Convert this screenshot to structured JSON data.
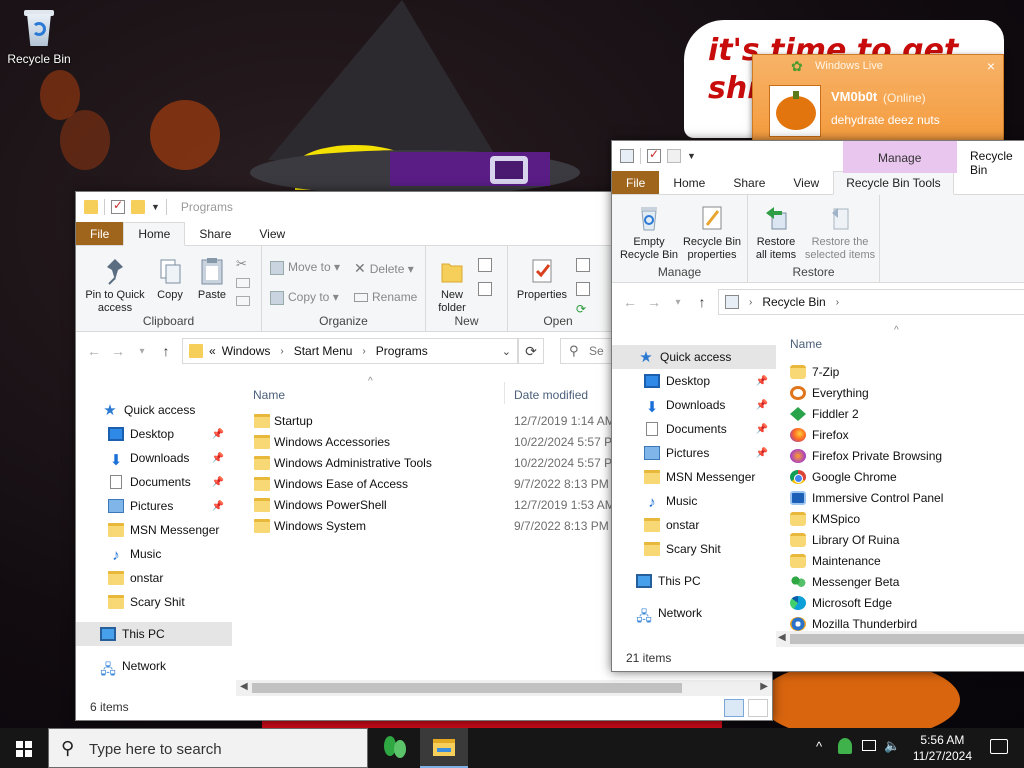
{
  "desktop": {
    "recycle_bin_label": "Recycle Bin",
    "wallpaper_text": "it's time to get shit and or t"
  },
  "msn_popup": {
    "app_title": "Windows Live",
    "contact_name": "VM0b0t",
    "status": "(Online)",
    "message": "dehydrate deez nuts",
    "close_glyph": "×"
  },
  "programs_window": {
    "title": "Programs",
    "tabs": [
      "File",
      "Home",
      "Share",
      "View"
    ],
    "active_tab": "Home",
    "ribbon": {
      "clipboard": {
        "pin": "Pin to Quick access",
        "copy": "Copy",
        "paste": "Paste",
        "label": "Clipboard"
      },
      "organize": {
        "move_to": "Move to",
        "copy_to": "Copy to",
        "delete": "Delete",
        "rename": "Rename",
        "label": "Organize"
      },
      "new": {
        "new_folder": "New folder",
        "label": "New"
      },
      "open": {
        "properties": "Properties",
        "label": "Open"
      }
    },
    "breadcrumb": [
      "«",
      "Windows",
      "Start Menu",
      "Programs"
    ],
    "search_placeholder": "Se",
    "columns": {
      "name": "Name",
      "date_modified": "Date modified"
    },
    "nav": {
      "quick_access": "Quick access",
      "items": [
        {
          "label": "Desktop",
          "pinned": true
        },
        {
          "label": "Downloads",
          "pinned": true
        },
        {
          "label": "Documents",
          "pinned": true
        },
        {
          "label": "Pictures",
          "pinned": true
        },
        {
          "label": "MSN Messenger",
          "pinned": false
        },
        {
          "label": "Music",
          "pinned": false
        },
        {
          "label": "onstar",
          "pinned": false
        },
        {
          "label": "Scary Shit",
          "pinned": false
        }
      ],
      "this_pc": "This PC",
      "network": "Network"
    },
    "files": [
      {
        "name": "Startup",
        "date": "12/7/2019 1:14 AM"
      },
      {
        "name": "Windows Accessories",
        "date": "10/22/2024 5:57 PM"
      },
      {
        "name": "Windows Administrative Tools",
        "date": "10/22/2024 5:57 PM"
      },
      {
        "name": "Windows Ease of Access",
        "date": "9/7/2022 8:13 PM"
      },
      {
        "name": "Windows PowerShell",
        "date": "12/7/2019 1:53 AM"
      },
      {
        "name": "Windows System",
        "date": "9/7/2022 8:13 PM"
      }
    ],
    "status": "6 items"
  },
  "recycle_window": {
    "title": "Recycle Bin",
    "contextual_group": "Manage",
    "tabs": [
      "File",
      "Home",
      "Share",
      "View",
      "Recycle Bin Tools"
    ],
    "active_tab": "Recycle Bin Tools",
    "ribbon": {
      "manage": {
        "empty": "Empty Recycle Bin",
        "properties": "Recycle Bin properties",
        "label": "Manage"
      },
      "restore": {
        "restore_all": "Restore all items",
        "restore_selected": "Restore the selected items",
        "label": "Restore"
      }
    },
    "breadcrumb": [
      "Recycle Bin"
    ],
    "columns": {
      "name": "Name"
    },
    "nav": {
      "quick_access": "Quick access",
      "items": [
        {
          "label": "Desktop",
          "pinned": true
        },
        {
          "label": "Downloads",
          "pinned": true
        },
        {
          "label": "Documents",
          "pinned": true
        },
        {
          "label": "Pictures",
          "pinned": true
        },
        {
          "label": "MSN Messenger",
          "pinned": false
        },
        {
          "label": "Music",
          "pinned": false
        },
        {
          "label": "onstar",
          "pinned": false
        },
        {
          "label": "Scary Shit",
          "pinned": false
        }
      ],
      "this_pc": "This PC",
      "network": "Network"
    },
    "files": [
      {
        "name": "7-Zip",
        "icon": "folder-icon"
      },
      {
        "name": "Everything",
        "icon": "everything-icon"
      },
      {
        "name": "Fiddler 2",
        "icon": "fiddler-icon"
      },
      {
        "name": "Firefox",
        "icon": "firefox-icon"
      },
      {
        "name": "Firefox Private Browsing",
        "icon": "firefox-private-icon"
      },
      {
        "name": "Google Chrome",
        "icon": "chrome-icon"
      },
      {
        "name": "Immersive Control Panel",
        "icon": "control-panel-icon"
      },
      {
        "name": "KMSpico",
        "icon": "folder-icon"
      },
      {
        "name": "Library Of Ruina",
        "icon": "folder-icon"
      },
      {
        "name": "Maintenance",
        "icon": "folder-icon"
      },
      {
        "name": "Messenger Beta",
        "icon": "messenger-icon"
      },
      {
        "name": "Microsoft Edge",
        "icon": "edge-icon"
      },
      {
        "name": "Mozilla Thunderbird",
        "icon": "thunderbird-icon"
      }
    ],
    "status": "21 items"
  },
  "taskbar": {
    "search_placeholder": "Type here to search",
    "time": "5:56 AM",
    "date": "11/27/2024"
  }
}
